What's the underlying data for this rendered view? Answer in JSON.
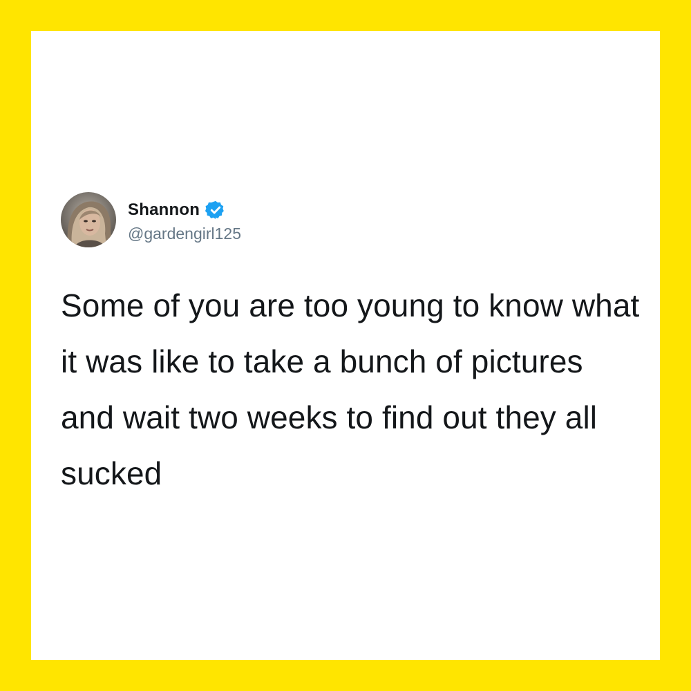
{
  "colors": {
    "border": "#FFE500",
    "card": "#FFFFFF",
    "text": "#14171A",
    "handle": "#657786",
    "verified": "#1DA1F2"
  },
  "tweet": {
    "display_name": "Shannon",
    "handle": "@gardengirl125",
    "verified_icon": "verified-badge-icon",
    "avatar": "profile-photo",
    "text": "Some of you are too young to know what it was like to take a bunch of pictures and wait two weeks to find out they all sucked"
  }
}
